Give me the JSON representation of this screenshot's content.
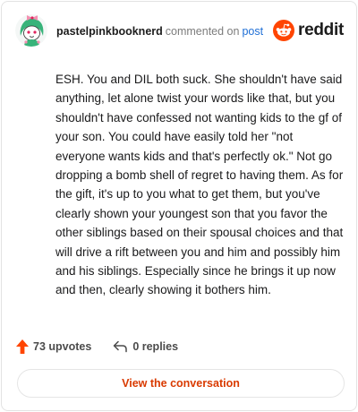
{
  "header": {
    "username": "pastelpinkbooknerd",
    "action_text": "commented on",
    "post_link": "post",
    "brand": "reddit"
  },
  "comment": {
    "text": "ESH. You and DIL both suck. She shouldn't have said anything, let alone twist your words like that, but you shouldn't have confessed not wanting kids to the gf of your son. You could have easily told her \"not everyone wants kids and that's perfectly ok.\" Not go dropping a bomb shell of regret to having them. As for the gift, it's up to you what to get them, but you've clearly shown your youngest son that you favor the other siblings based on their spousal choices and that will drive a rift between you and him and possibly him and his siblings. Especially since he brings it up now and then, clearly showing it bothers him."
  },
  "stats": {
    "upvotes": "73 upvotes",
    "replies": "0 replies"
  },
  "cta": {
    "label": "View the conversation"
  },
  "colors": {
    "brand_orange": "#ff4500",
    "cta_text": "#d93a00",
    "link_blue": "#1f6fd6",
    "muted_text": "#7c7c7c"
  },
  "icons": {
    "avatar": "snoo-avatar-green-pink",
    "logo": "reddit-snoo-logo",
    "upvote": "upvote-arrow-icon",
    "reply": "reply-arrow-icon"
  }
}
